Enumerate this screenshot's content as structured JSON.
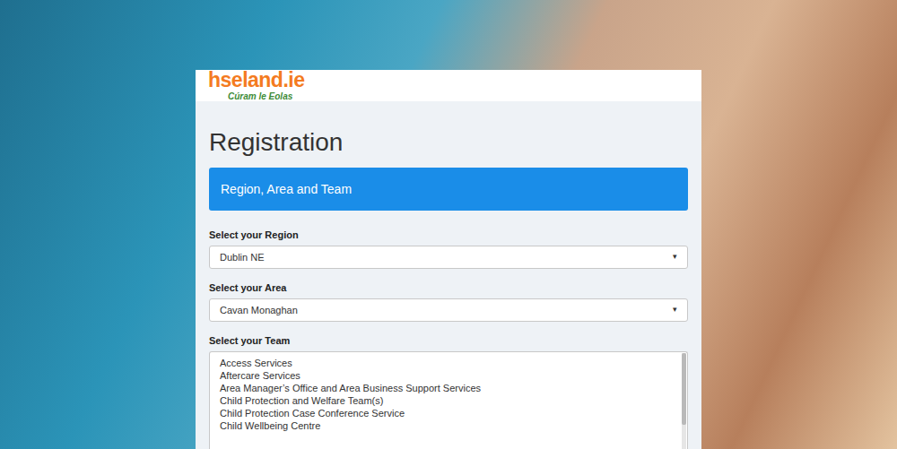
{
  "logo": {
    "name": "hseland.ie",
    "tagline": "Cúram le Eolas"
  },
  "form": {
    "title": "Registration",
    "section": "Region, Area and Team",
    "fields": [
      {
        "kind": "select",
        "label": "Select your Region",
        "value": "Dublin NE",
        "arrow": "▾"
      },
      {
        "kind": "select",
        "label": "Select your Area",
        "value": "Cavan Monaghan",
        "arrow": "▾"
      },
      {
        "kind": "listbox",
        "label": "Select your Team",
        "options": [
          {
            "label": "Access Services",
            "selected": false
          },
          {
            "label": "Aftercare Services",
            "selected": false
          },
          {
            "label": "Area Manager’s Office and Area Business Support Services",
            "selected": false
          },
          {
            "label": "Child Protection and Welfare Team(s)",
            "selected": false
          },
          {
            "label": "Child Protection Case Conference Service",
            "selected": false
          },
          {
            "label": "Child Wellbeing Centre",
            "selected": false
          }
        ]
      }
    ]
  }
}
